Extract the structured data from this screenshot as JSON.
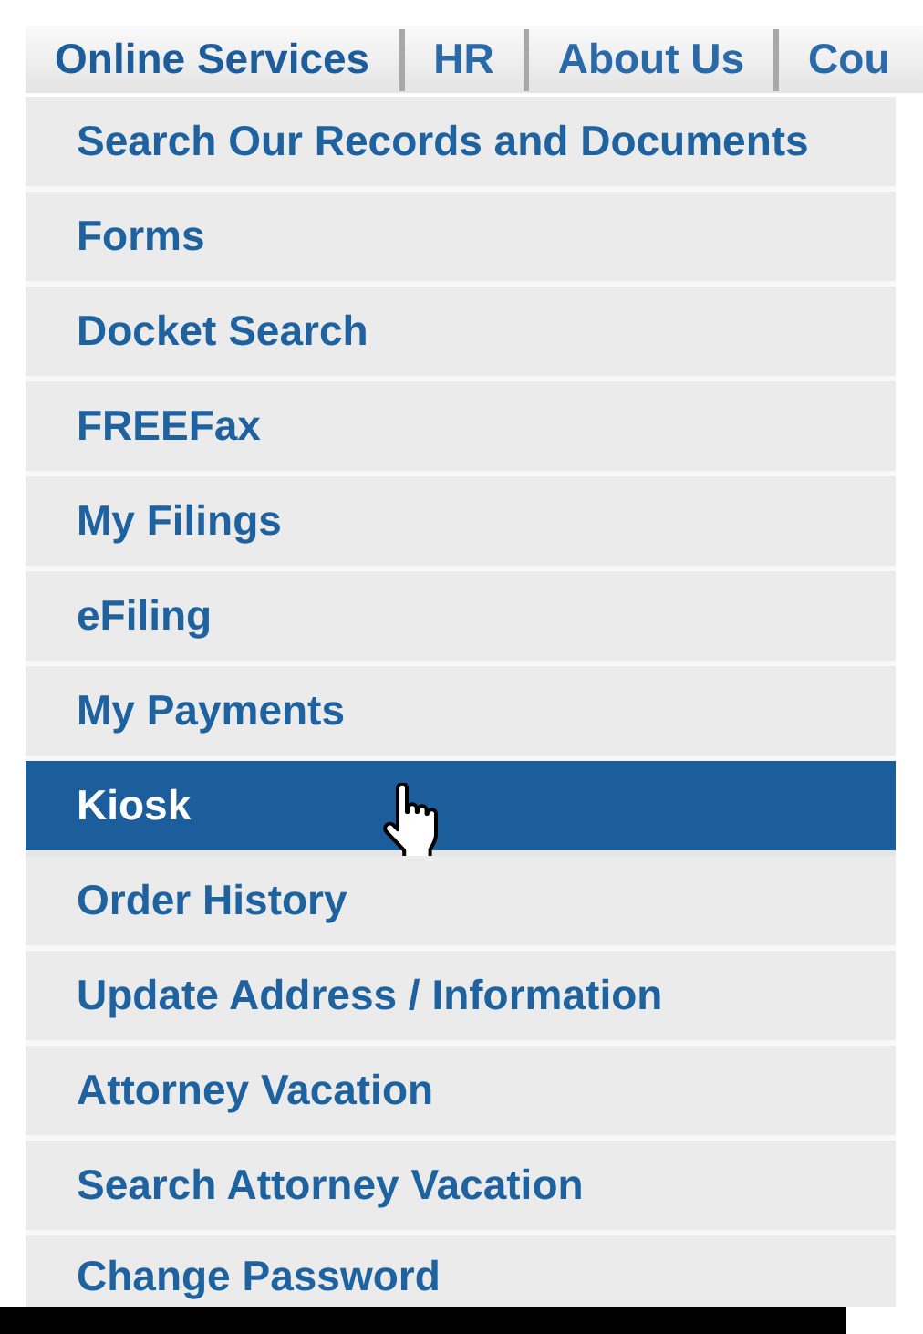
{
  "nav_tabs": [
    {
      "label": "Online Services",
      "selected": true
    },
    {
      "label": "HR",
      "selected": false
    },
    {
      "label": "About Us",
      "selected": false
    },
    {
      "label": "Cou",
      "selected": false
    }
  ],
  "menu_items": [
    {
      "label": "Search Our Records and Documents",
      "selected": false
    },
    {
      "label": "Forms",
      "selected": false
    },
    {
      "label": "Docket Search",
      "selected": false
    },
    {
      "label": "FREEFax",
      "selected": false
    },
    {
      "label": "My Filings",
      "selected": false
    },
    {
      "label": "eFiling",
      "selected": false
    },
    {
      "label": "My Payments",
      "selected": false
    },
    {
      "label": "Kiosk",
      "selected": true
    },
    {
      "label": "Order History",
      "selected": false
    },
    {
      "label": "Update Address / Information",
      "selected": false
    },
    {
      "label": "Attorney Vacation",
      "selected": false
    },
    {
      "label": "Search Attorney Vacation",
      "selected": false
    },
    {
      "label": "Change Password",
      "selected": false
    }
  ]
}
